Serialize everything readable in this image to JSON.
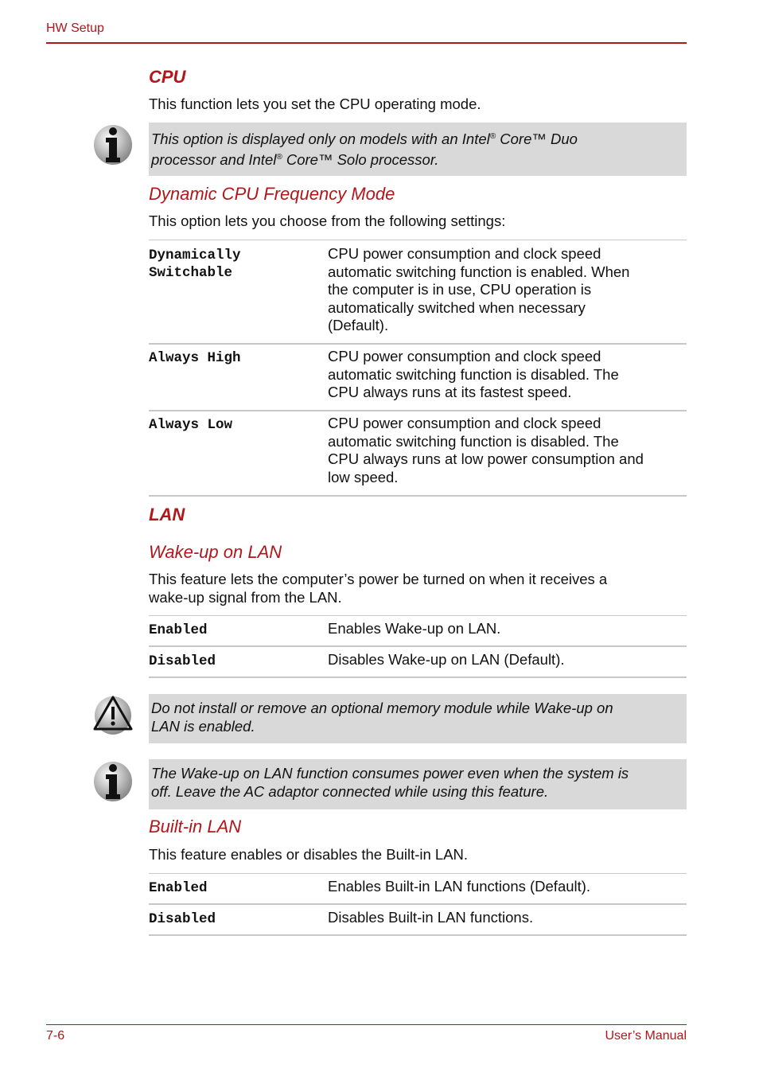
{
  "header": {
    "section": "HW Setup"
  },
  "cpu": {
    "title": "CPU",
    "intro": "This function lets you set the CPU operating mode.",
    "note": {
      "icon": "info-icon",
      "line1_a": "This option is displayed only on models with an Intel",
      "reg": "®",
      "line1_b": " Core™ Duo",
      "line2_a": "processor and Intel",
      "line2_b": " Core™ Solo processor."
    },
    "dynamic": {
      "title": "Dynamic CPU Frequency Mode",
      "intro": "This option lets you choose from the following settings:",
      "rows": [
        {
          "term_l1": "Dynamically",
          "term_l2": "Switchable",
          "desc": [
            "CPU power consumption and clock speed",
            "automatic switching function is enabled. When",
            "the computer is in use, CPU operation is",
            "automatically switched when necessary",
            "(Default)."
          ]
        },
        {
          "term_l1": "Always High",
          "term_l2": "",
          "desc": [
            "CPU power consumption and clock speed",
            "automatic switching function is disabled. The",
            "CPU always runs at its fastest speed."
          ]
        },
        {
          "term_l1": "Always Low",
          "term_l2": "",
          "desc": [
            "CPU power consumption and clock speed",
            "automatic switching function is disabled. The",
            "CPU always runs at low power consumption and",
            "low speed."
          ]
        }
      ]
    }
  },
  "lan": {
    "title": "LAN",
    "wol": {
      "title": "Wake-up on LAN",
      "intro_l1": "This feature lets the computer’s power be turned on when it receives a",
      "intro_l2": "wake-up signal from the LAN.",
      "rows": [
        {
          "term": "Enabled",
          "desc": "Enables Wake-up on LAN."
        },
        {
          "term": "Disabled",
          "desc": "Disables Wake-up on LAN (Default)."
        }
      ]
    },
    "caution": {
      "icon": "warning-icon",
      "l1": "Do not install or remove an optional memory module while Wake-up on",
      "l2": "LAN is enabled."
    },
    "info": {
      "icon": "info-icon",
      "l1": "The Wake-up on LAN function consumes power even when the system is",
      "l2": "off. Leave the AC adaptor connected while using this feature."
    },
    "builtin": {
      "title": "Built-in LAN",
      "intro": "This feature enables or disables the Built-in LAN.",
      "rows": [
        {
          "term": "Enabled",
          "desc": "Enables Built-in LAN functions (Default)."
        },
        {
          "term": "Disabled",
          "desc": "Disables Built-in LAN functions."
        }
      ]
    }
  },
  "footer": {
    "page": "7-6",
    "manual": "User’s Manual"
  },
  "colors": {
    "accent": "#b2161b",
    "note_bg": "#d9d9d9",
    "rule": "#c8c8c8"
  }
}
